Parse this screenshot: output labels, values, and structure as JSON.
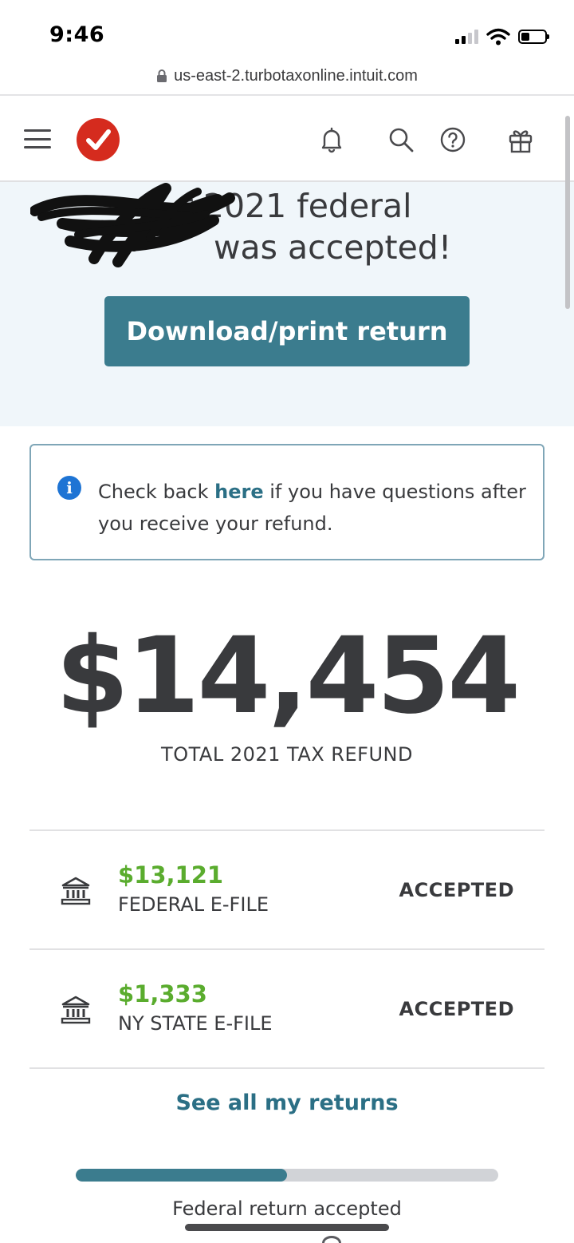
{
  "status_bar": {
    "time": "9:46",
    "url": "us-east-2.turbotaxonline.intuit.com"
  },
  "header": {
    "icons": [
      "menu-icon",
      "turbotax-logo",
      "bell-icon",
      "search-icon",
      "help-icon",
      "gift-icon"
    ]
  },
  "hero": {
    "title_line1": "r 2021 federal",
    "title_line2": "was accepted!",
    "download_label": "Download/print return"
  },
  "info": {
    "text_before": "Check back ",
    "link": "here",
    "text_after": " if you have questions after you receive your refund."
  },
  "refund": {
    "amount": "$14,454",
    "label": "TOTAL 2021 TAX REFUND"
  },
  "returns": [
    {
      "amount": "$13,121",
      "label": "FEDERAL E-FILE",
      "status": "ACCEPTED"
    },
    {
      "amount": "$1,333",
      "label": "NY STATE E-FILE",
      "status": "ACCEPTED"
    }
  ],
  "see_all": "See all my returns",
  "progress": {
    "fraction": 0.5,
    "label": "Federal return accepted"
  },
  "colors": {
    "brand_red": "#d52b1e",
    "teal": "#3b7c8e",
    "link": "#2b6f85",
    "green": "#5aac2e",
    "hero_bg": "#f0f6fa",
    "info_blue": "#1e74d4"
  }
}
